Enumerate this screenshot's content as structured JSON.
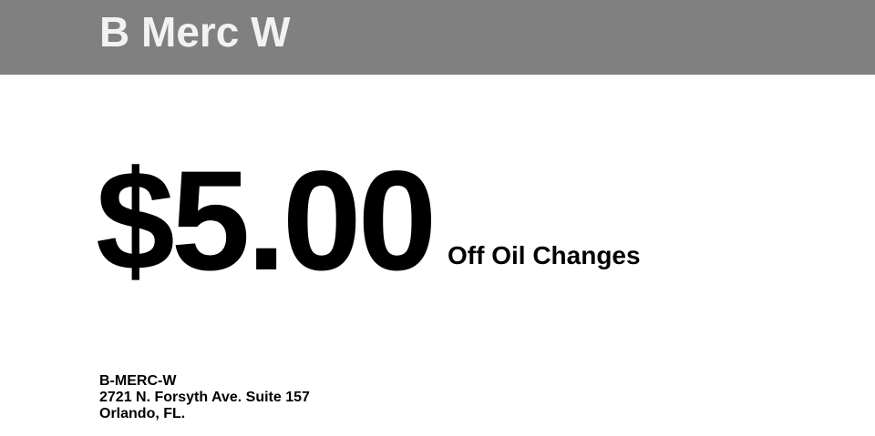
{
  "header": {
    "brand": "B Merc W",
    "background_color": "#808080",
    "text_color": "#f2f2f2"
  },
  "offer": {
    "amount": "$5.00",
    "description": "Off Oil Changes"
  },
  "address": {
    "name": "B-MERC-W",
    "street": "2721 N. Forsyth Ave. Suite 157",
    "city": "Orlando, FL."
  }
}
